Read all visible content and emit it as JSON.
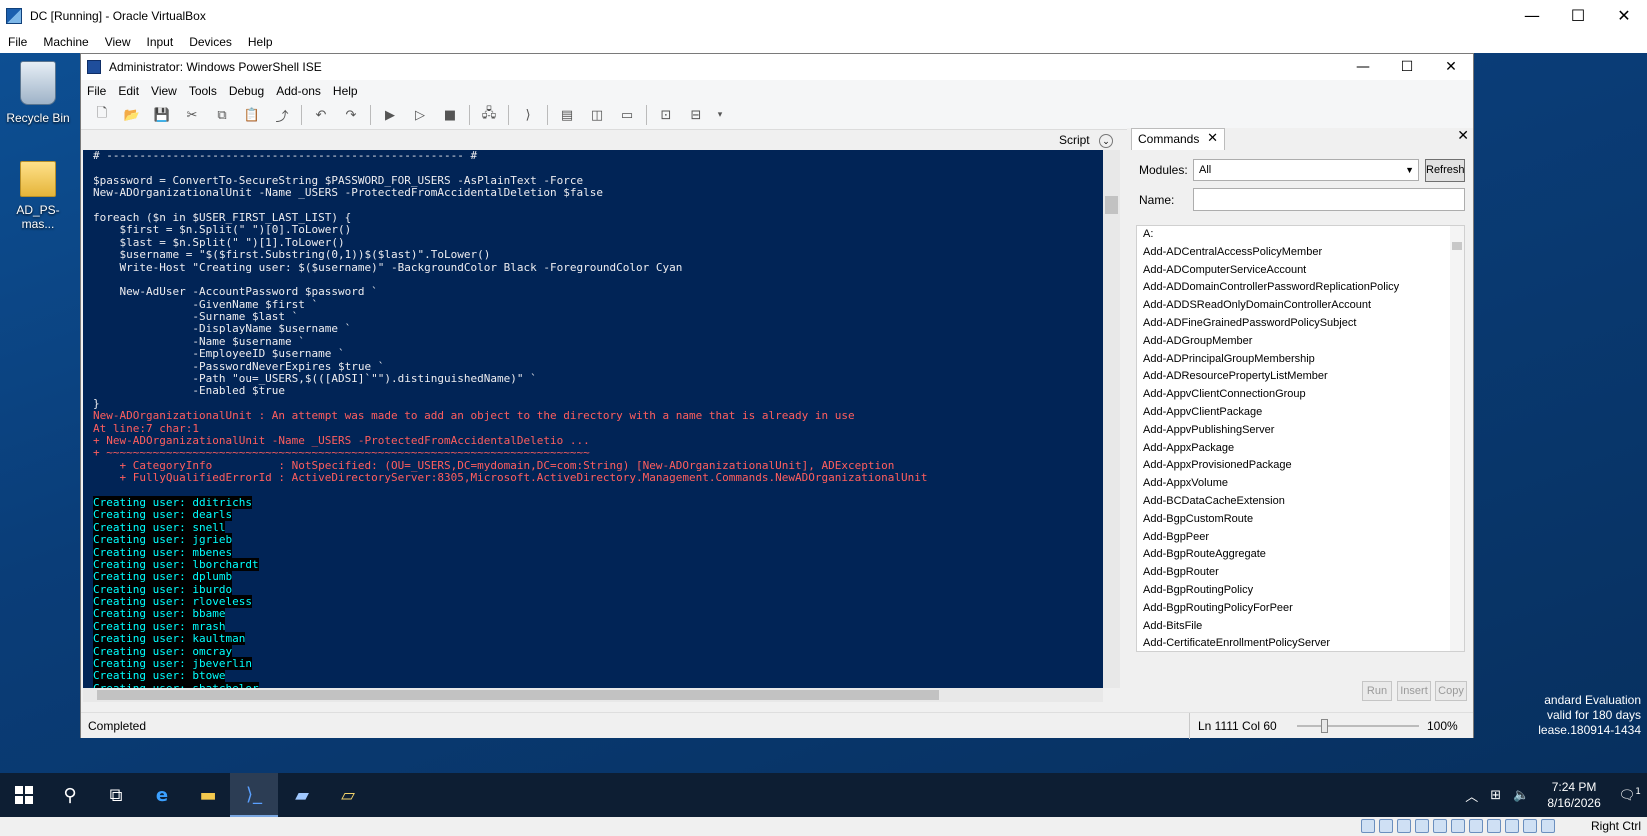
{
  "vbox": {
    "title": "DC [Running] - Oracle VirtualBox",
    "menu": [
      "File",
      "Machine",
      "View",
      "Input",
      "Devices",
      "Help"
    ],
    "window_controls": {
      "minimize": "—",
      "maximize": "☐",
      "close": "✕"
    },
    "host_key": "Right Ctrl"
  },
  "desktop": {
    "icons": [
      "Recycle Bin",
      "AD_PS-mas..."
    ],
    "eval_watermark": [
      "andard Evaluation",
      "valid for 180 days",
      "lease.180914-1434"
    ]
  },
  "ise": {
    "title": "Administrator: Windows PowerShell ISE",
    "menu": [
      "File",
      "Edit",
      "View",
      "Tools",
      "Debug",
      "Add-ons",
      "Help"
    ],
    "script_label": "Script",
    "status": "Completed",
    "ln_col": "Ln 1111  Col 60",
    "zoom": "100%",
    "console_lines": [
      {
        "t": "# ------------------------------------------------------ #",
        "c": "w"
      },
      {
        "t": "",
        "c": "w"
      },
      {
        "t": "$password = ConvertTo-SecureString $PASSWORD_FOR_USERS -AsPlainText -Force",
        "c": "w"
      },
      {
        "t": "New-ADOrganizationalUnit -Name _USERS -ProtectedFromAccidentalDeletion $false",
        "c": "w"
      },
      {
        "t": "",
        "c": "w"
      },
      {
        "t": "foreach ($n in $USER_FIRST_LAST_LIST) {",
        "c": "w"
      },
      {
        "t": "    $first = $n.Split(\" \")[0].ToLower()",
        "c": "w"
      },
      {
        "t": "    $last = $n.Split(\" \")[1].ToLower()",
        "c": "w"
      },
      {
        "t": "    $username = \"$($first.Substring(0,1))$($last)\".ToLower()",
        "c": "w"
      },
      {
        "t": "    Write-Host \"Creating user: $($username)\" -BackgroundColor Black -ForegroundColor Cyan",
        "c": "w"
      },
      {
        "t": "",
        "c": "w"
      },
      {
        "t": "    New-AdUser -AccountPassword $password `",
        "c": "w"
      },
      {
        "t": "               -GivenName $first `",
        "c": "w"
      },
      {
        "t": "               -Surname $last `",
        "c": "w"
      },
      {
        "t": "               -DisplayName $username `",
        "c": "w"
      },
      {
        "t": "               -Name $username `",
        "c": "w"
      },
      {
        "t": "               -EmployeeID $username `",
        "c": "w"
      },
      {
        "t": "               -PasswordNeverExpires $true `",
        "c": "w"
      },
      {
        "t": "               -Path \"ou=_USERS,$(([ADSI]`\"\").distinguishedName)\" `",
        "c": "w"
      },
      {
        "t": "               -Enabled $true",
        "c": "w"
      },
      {
        "t": "}",
        "c": "w"
      },
      {
        "t": "New-ADOrganizationalUnit : An attempt was made to add an object to the directory with a name that is already in use",
        "c": "r"
      },
      {
        "t": "At line:7 char:1",
        "c": "r"
      },
      {
        "t": "+ New-ADOrganizationalUnit -Name _USERS -ProtectedFromAccidentalDeletio ...",
        "c": "r"
      },
      {
        "t": "+ ~~~~~~~~~~~~~~~~~~~~~~~~~~~~~~~~~~~~~~~~~~~~~~~~~~~~~~~~~~~~~~~~~~~~~~~~~",
        "c": "r"
      },
      {
        "t": "    + CategoryInfo          : NotSpecified: (OU=_USERS,DC=mydomain,DC=com:String) [New-ADOrganizationalUnit], ADException",
        "c": "r"
      },
      {
        "t": "    + FullyQualifiedErrorId : ActiveDirectoryServer:8305,Microsoft.ActiveDirectory.Management.Commands.NewADOrganizationalUnit",
        "c": "r"
      },
      {
        "t": "",
        "c": "w"
      },
      {
        "t": "Creating user: dditrichs",
        "c": "c"
      },
      {
        "t": "Creating user: dearls",
        "c": "c"
      },
      {
        "t": "Creating user: snell",
        "c": "c"
      },
      {
        "t": "Creating user: jgrieb",
        "c": "c"
      },
      {
        "t": "Creating user: mbenes",
        "c": "c"
      },
      {
        "t": "Creating user: lborchardt",
        "c": "c"
      },
      {
        "t": "Creating user: dplumb",
        "c": "c"
      },
      {
        "t": "Creating user: iburdo",
        "c": "c"
      },
      {
        "t": "Creating user: rloveless",
        "c": "c"
      },
      {
        "t": "Creating user: bbame",
        "c": "c"
      },
      {
        "t": "Creating user: mrash",
        "c": "c"
      },
      {
        "t": "Creating user: kaultman",
        "c": "c"
      },
      {
        "t": "Creating user: omcray",
        "c": "c"
      },
      {
        "t": "Creating user: jbeverlin",
        "c": "c"
      },
      {
        "t": "Creating user: btowe",
        "c": "c"
      },
      {
        "t": "Creating user: sbatchelor",
        "c": "c"
      }
    ]
  },
  "commands": {
    "tab_label": "Commands",
    "modules_label": "Modules:",
    "modules_value": "All",
    "refresh_label": "Refresh",
    "name_label": "Name:",
    "items": [
      "A:",
      "Add-ADCentralAccessPolicyMember",
      "Add-ADComputerServiceAccount",
      "Add-ADDomainControllerPasswordReplicationPolicy",
      "Add-ADDSReadOnlyDomainControllerAccount",
      "Add-ADFineGrainedPasswordPolicySubject",
      "Add-ADGroupMember",
      "Add-ADPrincipalGroupMembership",
      "Add-ADResourcePropertyListMember",
      "Add-AppvClientConnectionGroup",
      "Add-AppvClientPackage",
      "Add-AppvPublishingServer",
      "Add-AppxPackage",
      "Add-AppxProvisionedPackage",
      "Add-AppxVolume",
      "Add-BCDataCacheExtension",
      "Add-BgpCustomRoute",
      "Add-BgpPeer",
      "Add-BgpRouteAggregate",
      "Add-BgpRouter",
      "Add-BgpRoutingPolicy",
      "Add-BgpRoutingPolicyForPeer",
      "Add-BitsFile",
      "Add-CertificateEnrollmentPolicyServer"
    ],
    "run_label": "Run",
    "insert_label": "Insert",
    "copy_label": "Copy"
  },
  "taskbar": {
    "time": "7:24 PM",
    "date": "8/16/2026",
    "notification_count": "1"
  }
}
